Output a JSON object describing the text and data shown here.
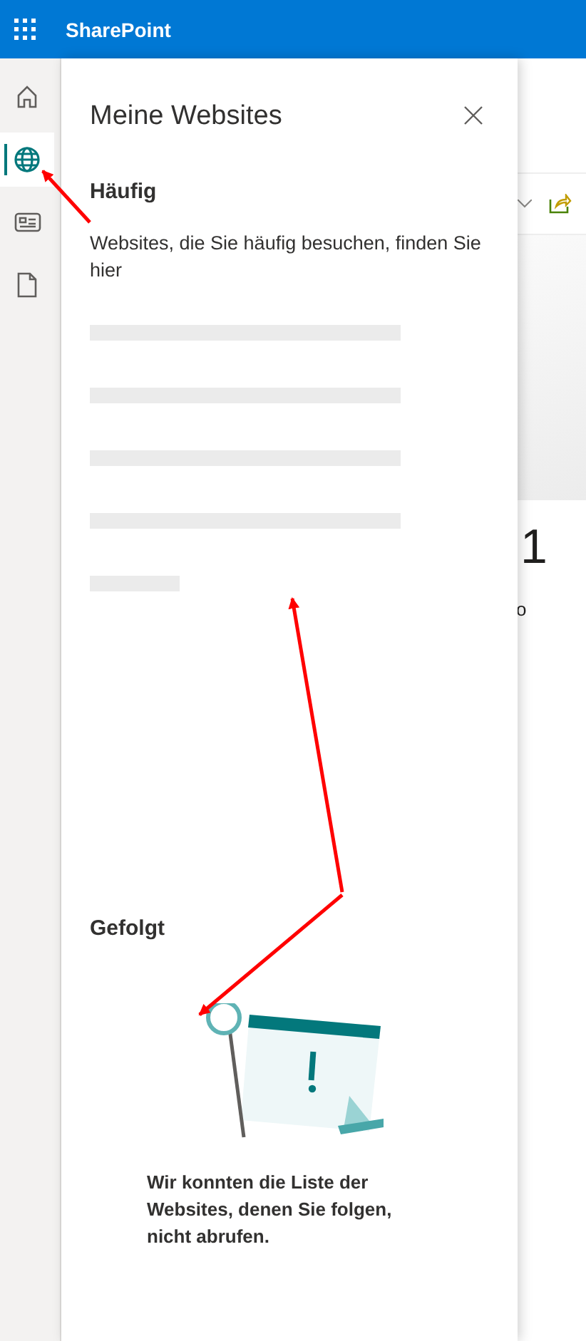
{
  "header": {
    "title": "SharePoint"
  },
  "nav": [
    {
      "kind": "home",
      "selected": false
    },
    {
      "kind": "globe",
      "selected": true
    },
    {
      "kind": "news",
      "selected": false
    },
    {
      "kind": "file",
      "selected": false
    }
  ],
  "background_page": {
    "heading": "1",
    "text": "o"
  },
  "panel": {
    "title": "Meine Websites",
    "frequent": {
      "heading": "Häufig",
      "description": "Websites, die Sie häufig besuchen, finden Sie hier",
      "placeholders": [
        {
          "kind": "long"
        },
        {
          "kind": "long"
        },
        {
          "kind": "long"
        },
        {
          "kind": "long"
        },
        {
          "kind": "short"
        }
      ]
    },
    "followed": {
      "heading": "Gefolgt",
      "message": "Wir konnten die Liste der Websites, denen Sie folgen, nicht abrufen."
    }
  }
}
